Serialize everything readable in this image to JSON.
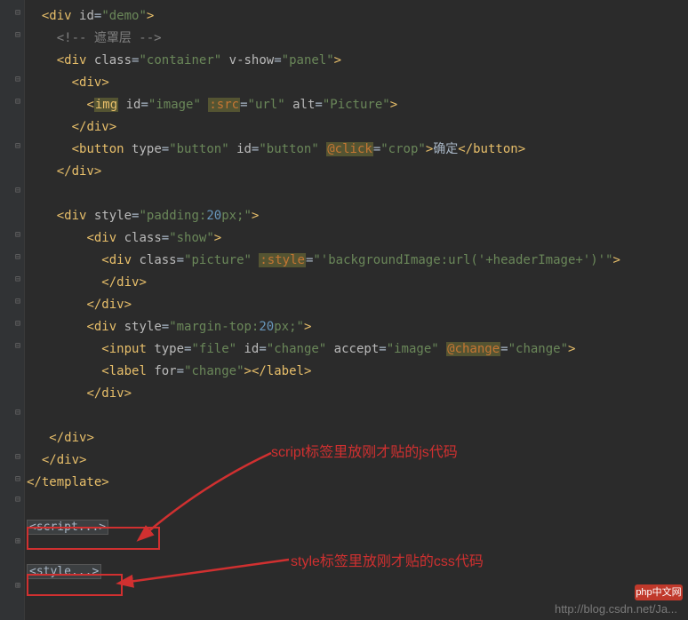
{
  "code": {
    "l1": {
      "open": "<",
      "tag": "div",
      "attr": "id",
      "val": "\"demo\"",
      "close": ">"
    },
    "l2": {
      "comment": "<!-- 遮罩层 -->"
    },
    "l3": {
      "open": "<",
      "tag": "div",
      "a1": "class",
      "v1": "\"container\"",
      "a2": "v-show",
      "v2": "\"panel\"",
      "close": ">"
    },
    "l4": {
      "open": "<",
      "tag": "div",
      "close": ">"
    },
    "l5": {
      "open": "<",
      "tag": "img",
      "a1": "id",
      "v1": "\"image\"",
      "a2": ":src",
      "v2": "\"url\"",
      "a3": "alt",
      "v3": "\"Picture\"",
      "close": ">"
    },
    "l6": {
      "open": "</",
      "tag": "div",
      "close": ">"
    },
    "l7": {
      "open": "<",
      "tag": "button",
      "a1": "type",
      "v1": "\"button\"",
      "a2": "id",
      "v2": "\"button\"",
      "a3": "@click",
      "v3": "\"crop\"",
      "close": ">",
      "text": "确定",
      "c_open": "</",
      "c_tag": "button",
      "c_close": ">"
    },
    "l8": {
      "open": "</",
      "tag": "div",
      "close": ">"
    },
    "l10": {
      "open": "<",
      "tag": "div",
      "a1": "style",
      "v1_pre": "\"padding:",
      "v1_num": "20",
      "v1_post": "px;\"",
      "close": ">"
    },
    "l11": {
      "open": "<",
      "tag": "div",
      "a1": "class",
      "v1": "\"show\"",
      "close": ">"
    },
    "l12": {
      "open": "<",
      "tag": "div",
      "a1": "class",
      "v1": "\"picture\"",
      "a2": ":style",
      "v2": "\"'backgroundImage:url('+headerImage+')'\"",
      "close": ">"
    },
    "l13": {
      "open": "</",
      "tag": "div",
      "close": ">"
    },
    "l14": {
      "open": "</",
      "tag": "div",
      "close": ">"
    },
    "l15": {
      "open": "<",
      "tag": "div",
      "a1": "style",
      "v1_pre": "\"margin-top:",
      "v1_num": "20",
      "v1_post": "px;\"",
      "close": ">"
    },
    "l16": {
      "open": "<",
      "tag": "input",
      "a1": "type",
      "v1": "\"file\"",
      "a2": "id",
      "v2": "\"change\"",
      "a3": "accept",
      "v3": "\"image\"",
      "a4": "@change",
      "v4": "\"change\"",
      "close": ">"
    },
    "l17": {
      "open": "<",
      "tag": "label",
      "a1": "for",
      "v1": "\"change\"",
      "close": ">",
      "c_open": "</",
      "c_tag": "label",
      "c_close": ">"
    },
    "l18": {
      "open": "</",
      "tag": "div",
      "close": ">"
    },
    "l20": {
      "open": "</",
      "tag": "div",
      "close": ">"
    },
    "l21": {
      "open": "</",
      "tag": "div",
      "close": ">"
    },
    "l22": {
      "open": "</",
      "tag": "template",
      "close": ">"
    },
    "script_fold": "<script...>",
    "style_fold": "<style...>"
  },
  "annotations": {
    "a1": "script标签里放刚才贴的js代码",
    "a2": "style标签里放刚才贴的css代码"
  },
  "watermark": {
    "badge": "php中文网",
    "url": "http://blog.csdn.net/Ja..."
  }
}
